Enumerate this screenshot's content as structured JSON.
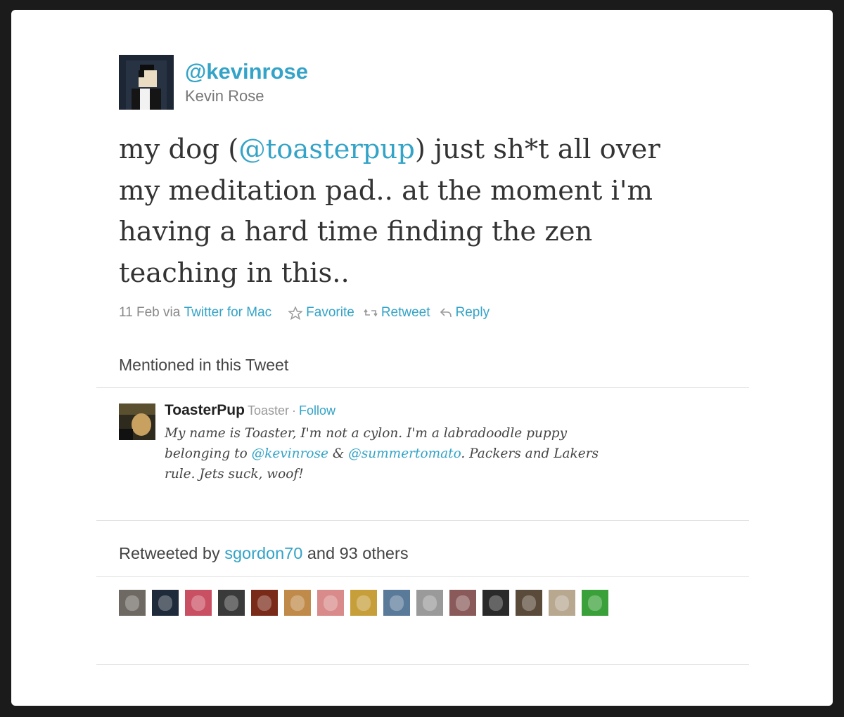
{
  "tweet": {
    "handle": "@kevinrose",
    "name": "Kevin Rose",
    "text_before": "my dog (",
    "mention": "@toasterpup",
    "text_after": ") just sh*t all over my meditation pad.. at the moment i'm having a hard time finding the zen teaching in this..",
    "date": "11 Feb via",
    "source": "Twitter for Mac",
    "favorite": "Favorite",
    "retweet": "Retweet",
    "reply": "Reply"
  },
  "mentioned": {
    "title": "Mentioned in this Tweet",
    "user": {
      "name": "ToasterPup",
      "screen_name": "Toaster",
      "dot": "·",
      "follow": "Follow",
      "bio_1": "My name is Toaster, I'm not a cylon. I'm a labradoodle puppy belonging to ",
      "bio_link1": "@kevinrose",
      "bio_2": " & ",
      "bio_link2": "@summertomato",
      "bio_3": ". Packers and Lakers rule. Jets suck, woof!"
    }
  },
  "retweets": {
    "prefix": "Retweeted by",
    "user": "sgordon70",
    "suffix": "and 93 others",
    "avatars": [
      {
        "name": "retweeter-avatar",
        "color": "#6e6a63"
      },
      {
        "name": "retweeter-avatar",
        "color": "#1f2b3a"
      },
      {
        "name": "retweeter-avatar",
        "color": "#c94f63"
      },
      {
        "name": "retweeter-avatar",
        "color": "#3a3a3a"
      },
      {
        "name": "retweeter-avatar",
        "color": "#7a2a18"
      },
      {
        "name": "retweeter-avatar",
        "color": "#c08a4a"
      },
      {
        "name": "retweeter-avatar",
        "color": "#d98a8a"
      },
      {
        "name": "retweeter-avatar",
        "color": "#c79f3a"
      },
      {
        "name": "retweeter-avatar",
        "color": "#5a7a9a"
      },
      {
        "name": "retweeter-avatar",
        "color": "#9a9a9a"
      },
      {
        "name": "retweeter-avatar",
        "color": "#8a5a5a"
      },
      {
        "name": "retweeter-avatar",
        "color": "#2a2a2a"
      },
      {
        "name": "retweeter-avatar",
        "color": "#5a4a3a"
      },
      {
        "name": "retweeter-avatar",
        "color": "#b8a890"
      },
      {
        "name": "retweeter-avatar",
        "color": "#3aa03a"
      }
    ]
  },
  "colors": {
    "link": "#33a3c7",
    "text": "#333333",
    "muted": "#888888"
  }
}
